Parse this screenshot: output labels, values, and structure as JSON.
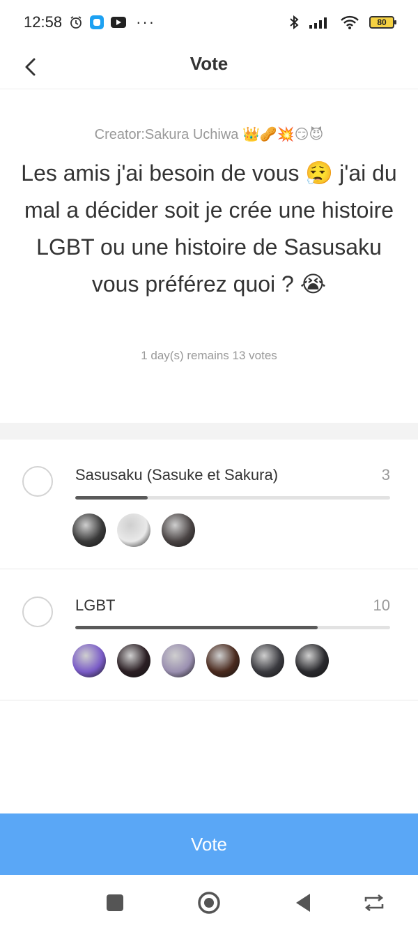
{
  "status_bar": {
    "time": "12:58",
    "battery": "80",
    "icons": [
      "alarm-icon",
      "app-notification-icon",
      "youtube-icon",
      "more-dots-icon",
      "bluetooth-icon",
      "signal-icon",
      "wifi-icon",
      "battery-icon"
    ]
  },
  "header": {
    "title": "Vote",
    "back_icon": "chevron-left-icon"
  },
  "poll": {
    "creator": "Creator:Sakura Uchiwa 👑🥜💥😏😈",
    "question": "Les amis j'ai besoin de vous 😮‍💨 j'ai du mal a décider soit je crée une histoire LGBT ou une histoire de Sasusaku vous préférez quoi ? 😭",
    "meta": "1 day(s) remains 13 votes",
    "total_votes": 13,
    "options": [
      {
        "label": "Sasusaku (Sasuke et Sakura)",
        "count": "3",
        "votes": 3,
        "fill_fraction": 0.23,
        "avatars": [
          "#3a3a3a",
          "#e9e9e9",
          "#4a4444"
        ]
      },
      {
        "label": "LGBT",
        "count": "10",
        "votes": 10,
        "fill_fraction": 0.77,
        "avatars": [
          "#7a5cc7",
          "#2b1f24",
          "#9a8fb0",
          "#4a2a1e",
          "#3a3a3f",
          "#2a2a2e"
        ]
      }
    ]
  },
  "vote_button": {
    "label": "Vote",
    "color": "#5aa7f6"
  },
  "nav_bar": {
    "items": [
      "square-icon",
      "home-circle-icon",
      "back-triangle-icon",
      "rotate-icon"
    ]
  }
}
